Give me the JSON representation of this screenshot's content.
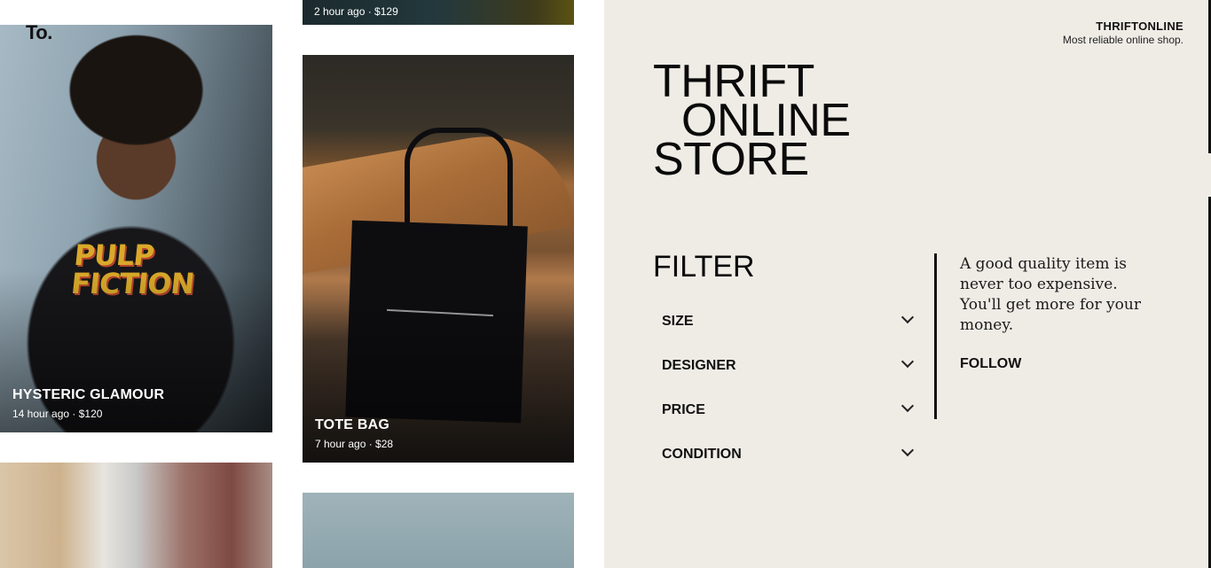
{
  "gallery": {
    "logo": "To.",
    "cards": [
      {
        "title": "HYSTERIC GLAMOUR",
        "meta": "14 hour ago · $120",
        "shirt_print": "PULP\nFICTION"
      },
      {
        "title": "",
        "meta": "2 hour ago · $129"
      },
      {
        "title": "TOTE BAG",
        "meta": "7 hour ago · $28"
      },
      {
        "title": "",
        "meta": ""
      },
      {
        "title": "",
        "meta": ""
      }
    ]
  },
  "brand": {
    "name": "THRIFTONLINE",
    "tagline": "Most reliable online shop."
  },
  "hero": {
    "line1": "THRIFT",
    "line2": "ONLINE",
    "line3": "STORE"
  },
  "filter": {
    "title": "FILTER",
    "options": [
      {
        "label": "SIZE",
        "icon": "chevron-down-icon"
      },
      {
        "label": "DESIGNER",
        "icon": "chevron-down-icon"
      },
      {
        "label": "PRICE",
        "icon": "chevron-down-icon"
      },
      {
        "label": "CONDITION",
        "icon": "chevron-down-icon"
      }
    ]
  },
  "aside": {
    "quote": "A good quality item is never too expensive. You'll get more for your money.",
    "follow_label": "FOLLOW"
  },
  "colors": {
    "panel_bg": "#efece6",
    "text": "#111111",
    "caption_text": "#ffffff"
  }
}
